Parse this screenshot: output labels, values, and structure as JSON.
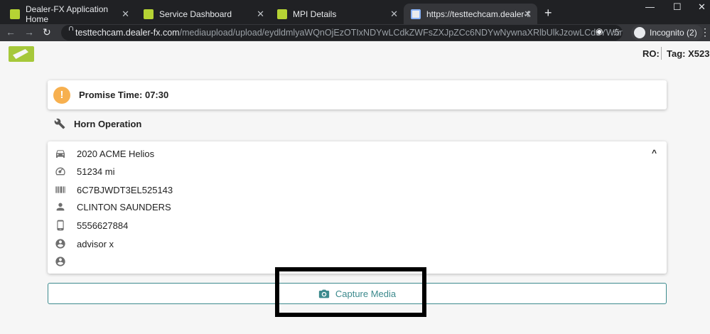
{
  "browser": {
    "tabs": [
      {
        "title": "Dealer-FX Application Home",
        "favicon": "dealer-fx-icon"
      },
      {
        "title": "Service Dashboard",
        "favicon": "dealer-fx-icon"
      },
      {
        "title": "MPI Details",
        "favicon": "dealer-fx-icon"
      },
      {
        "title": "https://testtechcam.dealer-fx.com",
        "favicon": "document-icon"
      }
    ],
    "new_tab": "+",
    "url_host": "testtechcam.dealer-fx.com",
    "url_path": "/mediaupload/upload/eydldmlyaWQnOjEzOTIxNDYwLCdkZWFsZXJpZCc6NDYwNywnaXRlbUlkJzowLCdsYW5nJzogJ2Vu...",
    "incognito_label": "Incognito (2)"
  },
  "header": {
    "ro_label": "RO:",
    "tag_label": "Tag: X523"
  },
  "promise": {
    "icon": "!",
    "text": "Promise Time: 07:30"
  },
  "operation": {
    "title": "Horn Operation"
  },
  "details": {
    "vehicle": "2020 ACME Helios",
    "mileage": "51234 mi",
    "vin": "6C7BJWDT3EL525143",
    "customer": "CLINTON SAUNDERS",
    "phone": "5556627884",
    "advisor": "advisor x",
    "technician": "",
    "collapse_icon": "^"
  },
  "capture": {
    "label": "Capture Media"
  },
  "colors": {
    "accent": "#3c8a8d",
    "warning": "#f7b04f",
    "brand": "#a6c83a"
  }
}
